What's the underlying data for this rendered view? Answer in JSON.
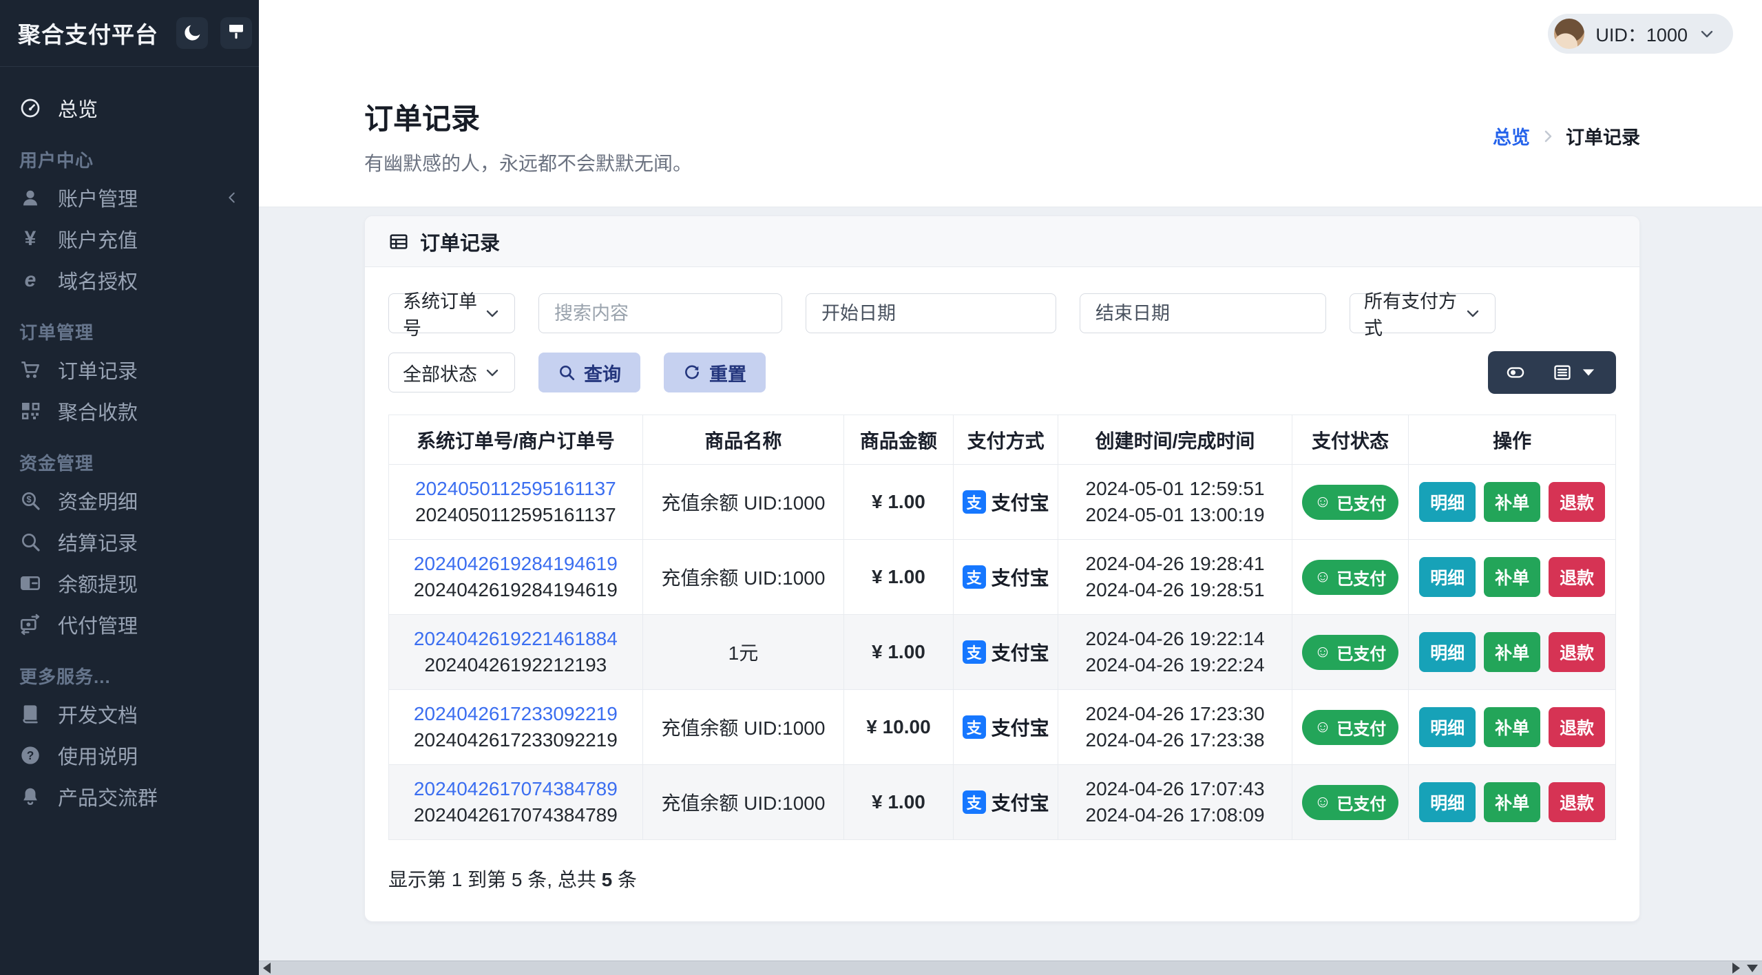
{
  "app": {
    "title": "聚合支付平台"
  },
  "topbar": {
    "theme_icons": [
      "moon-icon",
      "brush-icon"
    ],
    "uid": "UID：1000"
  },
  "sidebar": {
    "home": {
      "label": "总览",
      "icon": "gauge-icon"
    },
    "groups": [
      {
        "title": "用户中心",
        "items": [
          {
            "label": "账户管理",
            "icon": "user-icon",
            "has_arrow": true
          },
          {
            "label": "账户充值",
            "icon": "yen-icon"
          },
          {
            "label": "域名授权",
            "icon": "globe-icon"
          }
        ]
      },
      {
        "title": "订单管理",
        "items": [
          {
            "label": "订单记录",
            "icon": "cart-icon"
          },
          {
            "label": "聚合收款",
            "icon": "qr-icon"
          }
        ]
      },
      {
        "title": "资金管理",
        "items": [
          {
            "label": "资金明细",
            "icon": "search-dollar-icon"
          },
          {
            "label": "结算记录",
            "icon": "search-icon"
          },
          {
            "label": "余额提现",
            "icon": "credit-card-icon"
          },
          {
            "label": "代付管理",
            "icon": "money-transfer-icon"
          }
        ]
      },
      {
        "title": "更多服务...",
        "items": [
          {
            "label": "开发文档",
            "icon": "book-icon"
          },
          {
            "label": "使用说明",
            "icon": "question-icon"
          },
          {
            "label": "产品交流群",
            "icon": "bell-icon"
          }
        ]
      }
    ]
  },
  "page": {
    "title": "订单记录",
    "subtitle": "有幽默感的人，永远都不会默默无闻。",
    "breadcrumb": {
      "parent": "总览",
      "current": "订单记录"
    }
  },
  "card": {
    "header_title": "订单记录",
    "filters": {
      "order_type": "系统订单号",
      "search_placeholder": "搜索内容",
      "start_date": "开始日期",
      "end_date": "结束日期",
      "pay_method": "所有支付方式",
      "status": "全部状态",
      "query_label": "查询",
      "reset_label": "重置"
    },
    "table": {
      "columns": [
        "系统订单号/商户订单号",
        "商品名称",
        "商品金额",
        "支付方式",
        "创建时间/完成时间",
        "支付状态",
        "操作"
      ],
      "rows": [
        {
          "sys_no": "2024050112595161137",
          "merchant_no": "2024050112595161137",
          "product": "充值余额 UID:1000",
          "amount": "¥ 1.00",
          "method": "支付宝",
          "method_icon": "alipay-icon",
          "created": "2024-05-01 12:59:51",
          "completed": "2024-05-01 13:00:19",
          "status": "已支付"
        },
        {
          "sys_no": "2024042619284194619",
          "merchant_no": "2024042619284194619",
          "product": "充值余额 UID:1000",
          "amount": "¥ 1.00",
          "method": "支付宝",
          "method_icon": "alipay-icon",
          "created": "2024-04-26 19:28:41",
          "completed": "2024-04-26 19:28:51",
          "status": "已支付"
        },
        {
          "sys_no": "2024042619221461884",
          "merchant_no": "20240426192212193",
          "product": "1元",
          "amount": "¥ 1.00",
          "method": "支付宝",
          "method_icon": "alipay-icon",
          "created": "2024-04-26 19:22:14",
          "completed": "2024-04-26 19:22:24",
          "status": "已支付"
        },
        {
          "sys_no": "2024042617233092219",
          "merchant_no": "2024042617233092219",
          "product": "充值余额 UID:1000",
          "amount": "¥ 10.00",
          "method": "支付宝",
          "method_icon": "alipay-icon",
          "created": "2024-04-26 17:23:30",
          "completed": "2024-04-26 17:23:38",
          "status": "已支付"
        },
        {
          "sys_no": "2024042617074384789",
          "merchant_no": "2024042617074384789",
          "product": "充值余额 UID:1000",
          "amount": "¥ 1.00",
          "method": "支付宝",
          "method_icon": "alipay-icon",
          "created": "2024-04-26 17:07:43",
          "completed": "2024-04-26 17:08:09",
          "status": "已支付"
        }
      ],
      "actions": {
        "detail": "明细",
        "reissue": "补单",
        "refund": "退款"
      }
    },
    "footer": {
      "prefix": "显示第 1 到第 5 条, 总共 ",
      "total": "5",
      "suffix": " 条"
    }
  },
  "colors": {
    "sidebar_bg": "#1b2431",
    "link_blue": "#2563eb",
    "alipay_blue": "#1677ff",
    "success_green": "#23a559",
    "info_teal": "#17a2b8",
    "danger_red": "#d63354",
    "filter_button_bg": "#c6d1f0",
    "filter_button_text": "#24367d",
    "view_group_bg": "#2d3b50"
  }
}
